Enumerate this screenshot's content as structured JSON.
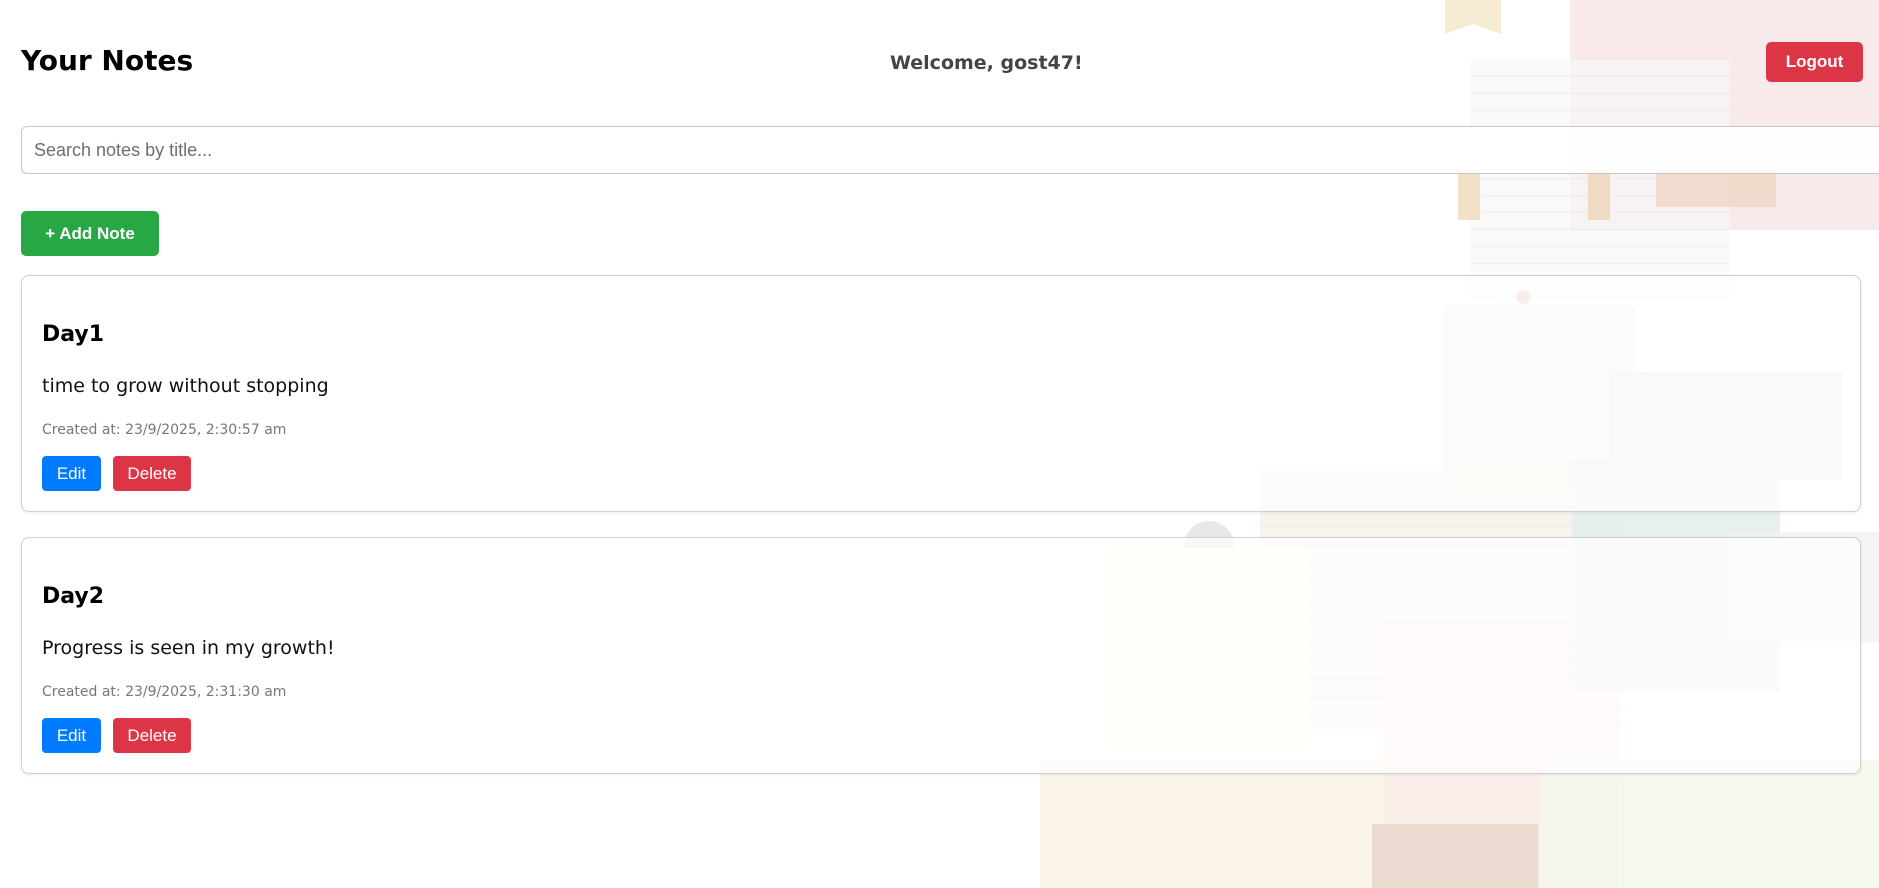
{
  "header": {
    "title": "Your Notes",
    "welcome": "Welcome, gost47!",
    "logout_label": "Logout"
  },
  "search": {
    "placeholder": "Search notes by title...",
    "value": ""
  },
  "toolbar": {
    "add_label": "+ Add Note"
  },
  "notes": [
    {
      "title": "Day1",
      "content": "time to grow without stopping",
      "created": "Created at: 23/9/2025, 2:30:57 am",
      "edit_label": "Edit",
      "delete_label": "Delete"
    },
    {
      "title": "Day2",
      "content": "Progress is seen in my growth!",
      "created": "Created at: 23/9/2025, 2:31:30 am",
      "edit_label": "Edit",
      "delete_label": "Delete"
    }
  ],
  "colors": {
    "primary": "#007bff",
    "danger": "#dc3545",
    "success": "#28a745"
  }
}
